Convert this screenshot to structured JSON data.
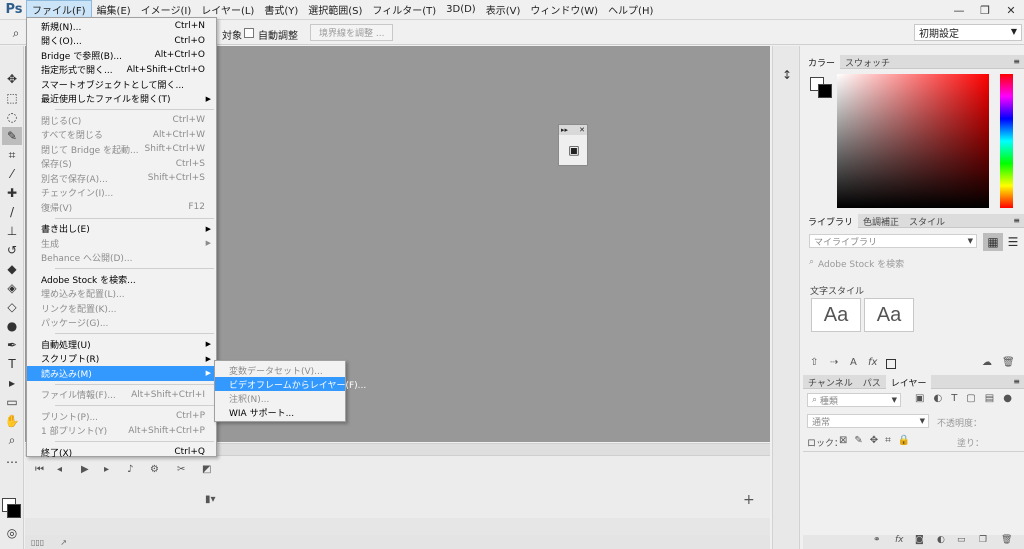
{
  "app": {
    "logo": "Ps"
  },
  "menubar": {
    "items": [
      "ファイル(F)",
      "編集(E)",
      "イメージ(I)",
      "レイヤー(L)",
      "書式(Y)",
      "選択範囲(S)",
      "フィルター(T)",
      "3D(D)",
      "表示(V)",
      "ウィンドウ(W)",
      "ヘルプ(H)"
    ]
  },
  "window": {
    "minimize": "—",
    "restore": "❐",
    "close": "✕"
  },
  "options_bar": {
    "target_label": "対象",
    "auto_adjust": "自動調整",
    "refine_edge": "境界線を調整 ...",
    "workspace": "初期設定"
  },
  "file_menu": {
    "groups": [
      [
        {
          "label": "新規(N)...",
          "shortcut": "Ctrl+N",
          "disabled": false
        },
        {
          "label": "開く(O)...",
          "shortcut": "Ctrl+O",
          "disabled": false
        },
        {
          "label": "Bridge で参照(B)...",
          "shortcut": "Alt+Ctrl+O",
          "disabled": false
        },
        {
          "label": "指定形式で開く...",
          "shortcut": "Alt+Shift+Ctrl+O",
          "disabled": false
        },
        {
          "label": "スマートオブジェクトとして開く...",
          "shortcut": "",
          "disabled": false
        },
        {
          "label": "最近使用したファイルを開く(T)",
          "shortcut": "",
          "disabled": false,
          "submenu": true
        }
      ],
      [
        {
          "label": "閉じる(C)",
          "shortcut": "Ctrl+W",
          "disabled": true
        },
        {
          "label": "すべてを閉じる",
          "shortcut": "Alt+Ctrl+W",
          "disabled": true
        },
        {
          "label": "閉じて Bridge を起動...",
          "shortcut": "Shift+Ctrl+W",
          "disabled": true
        },
        {
          "label": "保存(S)",
          "shortcut": "Ctrl+S",
          "disabled": true
        },
        {
          "label": "別名で保存(A)...",
          "shortcut": "Shift+Ctrl+S",
          "disabled": true
        },
        {
          "label": "チェックイン(I)...",
          "shortcut": "",
          "disabled": true
        },
        {
          "label": "復帰(V)",
          "shortcut": "F12",
          "disabled": true
        }
      ],
      [
        {
          "label": "書き出し(E)",
          "shortcut": "",
          "disabled": false,
          "submenu": true
        },
        {
          "label": "生成",
          "shortcut": "",
          "disabled": true,
          "submenu": true
        },
        {
          "label": "Behance へ公開(D)...",
          "shortcut": "",
          "disabled": true
        }
      ],
      [
        {
          "label": "Adobe Stock を検索...",
          "shortcut": "",
          "disabled": false
        },
        {
          "label": "埋め込みを配置(L)...",
          "shortcut": "",
          "disabled": true
        },
        {
          "label": "リンクを配置(K)...",
          "shortcut": "",
          "disabled": true
        },
        {
          "label": "パッケージ(G)...",
          "shortcut": "",
          "disabled": true
        }
      ],
      [
        {
          "label": "自動処理(U)",
          "shortcut": "",
          "disabled": false,
          "submenu": true
        },
        {
          "label": "スクリプト(R)",
          "shortcut": "",
          "disabled": false,
          "submenu": true
        },
        {
          "label": "読み込み(M)",
          "shortcut": "",
          "disabled": false,
          "submenu": true,
          "highlight": true
        }
      ],
      [
        {
          "label": "ファイル情報(F)...",
          "shortcut": "Alt+Shift+Ctrl+I",
          "disabled": true
        }
      ],
      [
        {
          "label": "プリント(P)...",
          "shortcut": "Ctrl+P",
          "disabled": true
        },
        {
          "label": "1 部プリント(Y)",
          "shortcut": "Alt+Shift+Ctrl+P",
          "disabled": true
        }
      ],
      [
        {
          "label": "終了(X)",
          "shortcut": "Ctrl+Q",
          "disabled": false
        }
      ]
    ]
  },
  "import_submenu": [
    {
      "label": "変数データセット(V)...",
      "disabled": true
    },
    {
      "label": "ビデオフレームからレイヤー(F)...",
      "disabled": false,
      "highlight": true
    },
    {
      "label": "注釈(N)...",
      "disabled": true
    },
    {
      "label": "WIA サポート...",
      "disabled": false
    }
  ],
  "color_panel": {
    "tabs": [
      "カラー",
      "スウォッチ"
    ],
    "active": 0
  },
  "library_panel": {
    "tabs": [
      "ライブラリ",
      "色調補正",
      "スタイル"
    ],
    "active": 0,
    "library_select": "マイライブラリ",
    "search_placeholder": "Adobe Stock を検索",
    "char_styles_title": "文字スタイル",
    "aa1": "Aa",
    "aa2": "Aa"
  },
  "layers_panel": {
    "tabs": [
      "チャンネル",
      "パス",
      "レイヤー"
    ],
    "active": 2,
    "kind": "種類",
    "blend": "通常",
    "opacity_label": "不透明度：",
    "lock_label": "ロック：",
    "fill_label": "塗り："
  },
  "statusbar": {
    "text": "▯▯▯"
  },
  "colors": {
    "accent": "#3399ff",
    "canvas": "#989898",
    "ps_blue": "#2f5e8d"
  }
}
